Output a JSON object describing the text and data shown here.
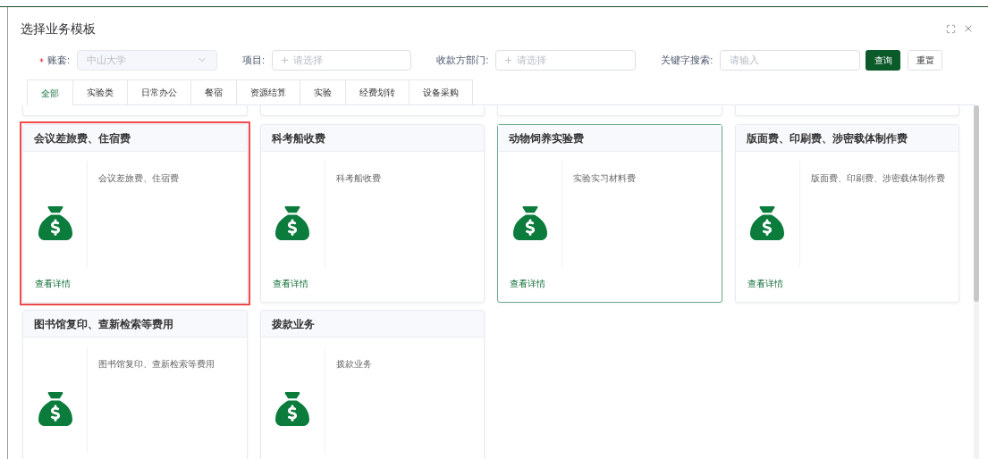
{
  "dialog": {
    "title": "选择业务模板"
  },
  "filters": [
    {
      "kind": "select",
      "label": "账套:",
      "required": true,
      "value": "中山大学",
      "disabled": true
    },
    {
      "kind": "picker",
      "label": "项目:",
      "required": false,
      "placeholder": "请选择"
    },
    {
      "kind": "picker",
      "label": "收款方部门:",
      "required": false,
      "placeholder": "请选择"
    },
    {
      "kind": "text",
      "label": "关键字搜索:",
      "required": false,
      "placeholder": "请输入"
    }
  ],
  "buttons": [
    {
      "label": "查询",
      "kind": "primary"
    },
    {
      "label": "重置",
      "kind": "default"
    }
  ],
  "tabs": [
    {
      "label": "全部",
      "selected": true
    },
    {
      "label": "实验类",
      "selected": false
    },
    {
      "label": "日常办公",
      "selected": false
    },
    {
      "label": "餐宿",
      "selected": false
    },
    {
      "label": "资源结算",
      "selected": false
    },
    {
      "label": "实验",
      "selected": false
    },
    {
      "label": "经费划转",
      "selected": false
    },
    {
      "label": "设备采购",
      "selected": false
    }
  ],
  "cards": [
    {
      "title": "会议差旅费、住宿费",
      "description": "会议差旅费、住宿费",
      "link": "查看详情",
      "highlighted": true,
      "selected": false
    },
    {
      "title": "科考船收费",
      "description": "科考船收费",
      "link": "查看详情",
      "highlighted": false,
      "selected": false
    },
    {
      "title": "动物饲养实验费",
      "description": "实验实习材料费",
      "link": "查看详情",
      "highlighted": false,
      "selected": true
    },
    {
      "title": "版面费、印刷费、涉密载体制作费",
      "description": "版面费、印刷费、涉密载体制作费",
      "link": "查看详情",
      "highlighted": false,
      "selected": false
    },
    {
      "title": "图书馆复印、查新检索等费用",
      "description": "图书馆复印、查新检索等费用",
      "highlighted": false,
      "selected": false
    },
    {
      "title": "拨款业务",
      "description": "拨款业务",
      "highlighted": false,
      "selected": false
    }
  ]
}
